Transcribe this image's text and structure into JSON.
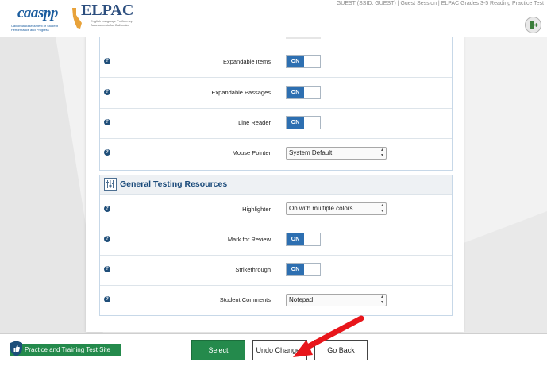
{
  "header": {
    "caaspp_logo": "caaspp",
    "caaspp_sub": "California Assessment of Student Performance and Progress",
    "elpac_logo": "ELPAC",
    "elpac_sub": "English Language Proficiency Assessments for California",
    "session_info": "GUEST (SSID: GUEST) | Guest Session | ELPAC Grades 3-5 Reading Practice Test",
    "exit_icon": "exit-door-icon"
  },
  "settings_top": {
    "rows": [
      {
        "label": "Expandable Items",
        "control": "toggle",
        "value": "ON"
      },
      {
        "label": "Expandable Passages",
        "control": "toggle",
        "value": "ON"
      },
      {
        "label": "Line Reader",
        "control": "toggle",
        "value": "ON"
      },
      {
        "label": "Mouse Pointer",
        "control": "select",
        "value": "System Default"
      }
    ]
  },
  "general": {
    "title": "General Testing Resources",
    "icon": "sliders-icon",
    "rows": [
      {
        "label": "Highlighter",
        "control": "select",
        "value": "On with multiple colors"
      },
      {
        "label": "Mark for Review",
        "control": "toggle",
        "value": "ON"
      },
      {
        "label": "Strikethrough",
        "control": "toggle",
        "value": "ON"
      },
      {
        "label": "Student Comments",
        "control": "select",
        "value": "Notepad"
      }
    ]
  },
  "help_glyph": "?",
  "footer": {
    "practice_label": "Practice and Training Test Site",
    "select_label": "Select",
    "undo_label": "Undo Changes",
    "back_label": "Go Back"
  },
  "colors": {
    "accent_blue": "#2d6fb1",
    "green": "#248a4c",
    "annotation_red": "#e8161b"
  }
}
